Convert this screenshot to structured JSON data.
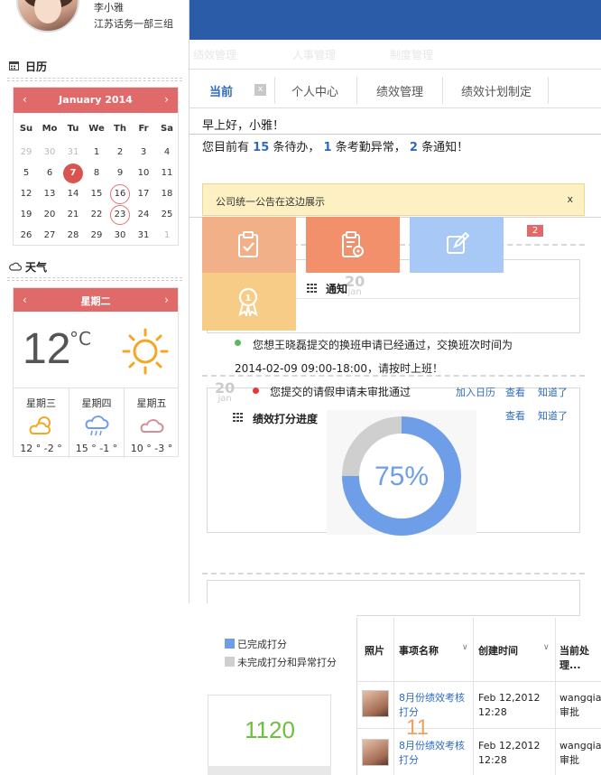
{
  "user": {
    "name": "李小雅",
    "department": "江苏话务一部三组"
  },
  "sidebar": {
    "calendar_title": "日历",
    "weather_title": "天气"
  },
  "calendar": {
    "month_label": "January 2014",
    "weekdays": [
      "Su",
      "Mo",
      "Tu",
      "We",
      "Th",
      "Fr",
      "Sa"
    ],
    "weeks": [
      [
        "29",
        "30",
        "31",
        "1",
        "2",
        "3",
        "4"
      ],
      [
        "5",
        "6",
        "7",
        "8",
        "9",
        "10",
        "11"
      ],
      [
        "12",
        "13",
        "14",
        "15",
        "16",
        "17",
        "18"
      ],
      [
        "19",
        "20",
        "21",
        "22",
        "23",
        "24",
        "25"
      ],
      [
        "26",
        "27",
        "28",
        "29",
        "30",
        "31",
        "1"
      ]
    ],
    "today": "7",
    "marked": [
      "16",
      "23"
    ]
  },
  "weather": {
    "day_label": "星期二",
    "current_temp": "12",
    "unit": "°C",
    "icon": "sun-icon",
    "forecast": [
      {
        "day": "星期三",
        "range": "12 ° -2 °",
        "icon": "partly-cloudy-icon"
      },
      {
        "day": "星期四",
        "range": "15 ° -1 °",
        "icon": "rain-icon"
      },
      {
        "day": "星期五",
        "range": "10 ° -3 °",
        "icon": "cloud-icon"
      }
    ]
  },
  "header": {
    "menu": [
      "绩效管理",
      "人事管理",
      "制度管理"
    ],
    "brand_color": "#2a5ca8"
  },
  "tabs": [
    {
      "label": "当前",
      "active": true,
      "close": "x"
    },
    {
      "label": "个人中心"
    },
    {
      "label": "绩效管理"
    },
    {
      "label": "绩效计划制定"
    }
  ],
  "main": {
    "greeting": "早上好，小雅！",
    "summary_prefix": "您目前有",
    "pending_count": "15",
    "pending_label": "条待办，",
    "attendance_count": "1",
    "attendance_label": "条考勤异常，",
    "notice_count": "2",
    "notice_label": "条通知！",
    "announcement": "公司统一公告在这边展示",
    "announcement_close": "x",
    "badge_count": "2"
  },
  "notifications": {
    "title": "通知",
    "date_day": "20",
    "date_month": "jan",
    "items": [
      {
        "text_line1": "您想王晓磊提交的换班申请已经通过，交换班次时间为",
        "text_line2": "2014-02-09 09:00-18:00，请按时上班！"
      },
      {
        "text": "您提交的请假申请未审批通过",
        "actions": [
          "加入日历",
          "查看",
          "知道了"
        ]
      }
    ]
  },
  "performance": {
    "title": "绩效打分进度",
    "date_day": "20",
    "date_month": "jan",
    "actions": [
      "查看",
      "知道了"
    ],
    "chart_data": {
      "type": "pie",
      "title": "",
      "center_label": "75%",
      "slices": [
        {
          "name": "已完成打分",
          "value": 75,
          "color": "#6f9ee8"
        },
        {
          "name": "未完成打分和异常打分",
          "value": 25,
          "color": "#cfcfcf"
        }
      ]
    },
    "legend": [
      {
        "label": "已完成打分",
        "color": "#6f9ee8"
      },
      {
        "label": "未完成打分和异常打分",
        "color": "#cfcfcf"
      }
    ]
  },
  "counters": {
    "big": "1120",
    "small": "11"
  },
  "table": {
    "headers": [
      "照片",
      "事项名称",
      "创建时间",
      "当前处理..."
    ],
    "rows": [
      {
        "item": "8月份绩效考核打分",
        "created": "Feb 12,2012 12:28",
        "handler": "wangqian 审批"
      },
      {
        "item": "8月份绩效考核打分",
        "created": "Feb 12,2012 12:28",
        "handler": "wangqian 审批"
      }
    ]
  }
}
